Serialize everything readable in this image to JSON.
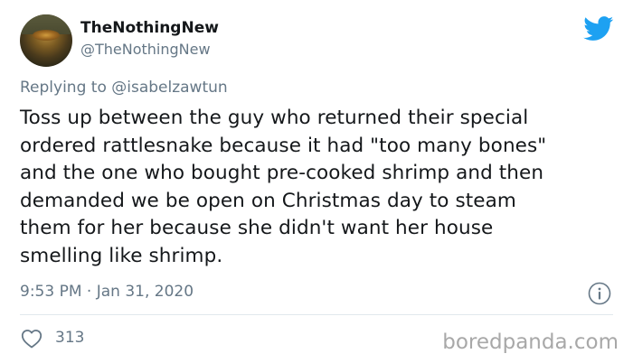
{
  "author": {
    "display_name": "TheNothingNew",
    "handle": "@TheNothingNew"
  },
  "reply": {
    "prefix": "Replying to",
    "mention": "@isabelzawtun"
  },
  "tweet": {
    "lines": [
      "Toss up between the guy who returned their special",
      "ordered rattlesnake because it had \"too many bones\"",
      "and the one who bought pre-cooked shrimp and then",
      "demanded we be open on Christmas day to steam",
      "them for her because she didn't want her house",
      "smelling like shrimp."
    ],
    "timestamp": "9:53 PM · Jan 31, 2020"
  },
  "actions": {
    "like_count": "313"
  },
  "watermark": "boredpanda.com",
  "icons": {
    "brand": "twitter-bird-icon",
    "info": "info-icon",
    "like": "heart-icon"
  },
  "colors": {
    "brand_blue": "#1da1f2",
    "secondary_text": "#657786",
    "primary_text": "#14171a",
    "divider": "#e1e8ed"
  }
}
